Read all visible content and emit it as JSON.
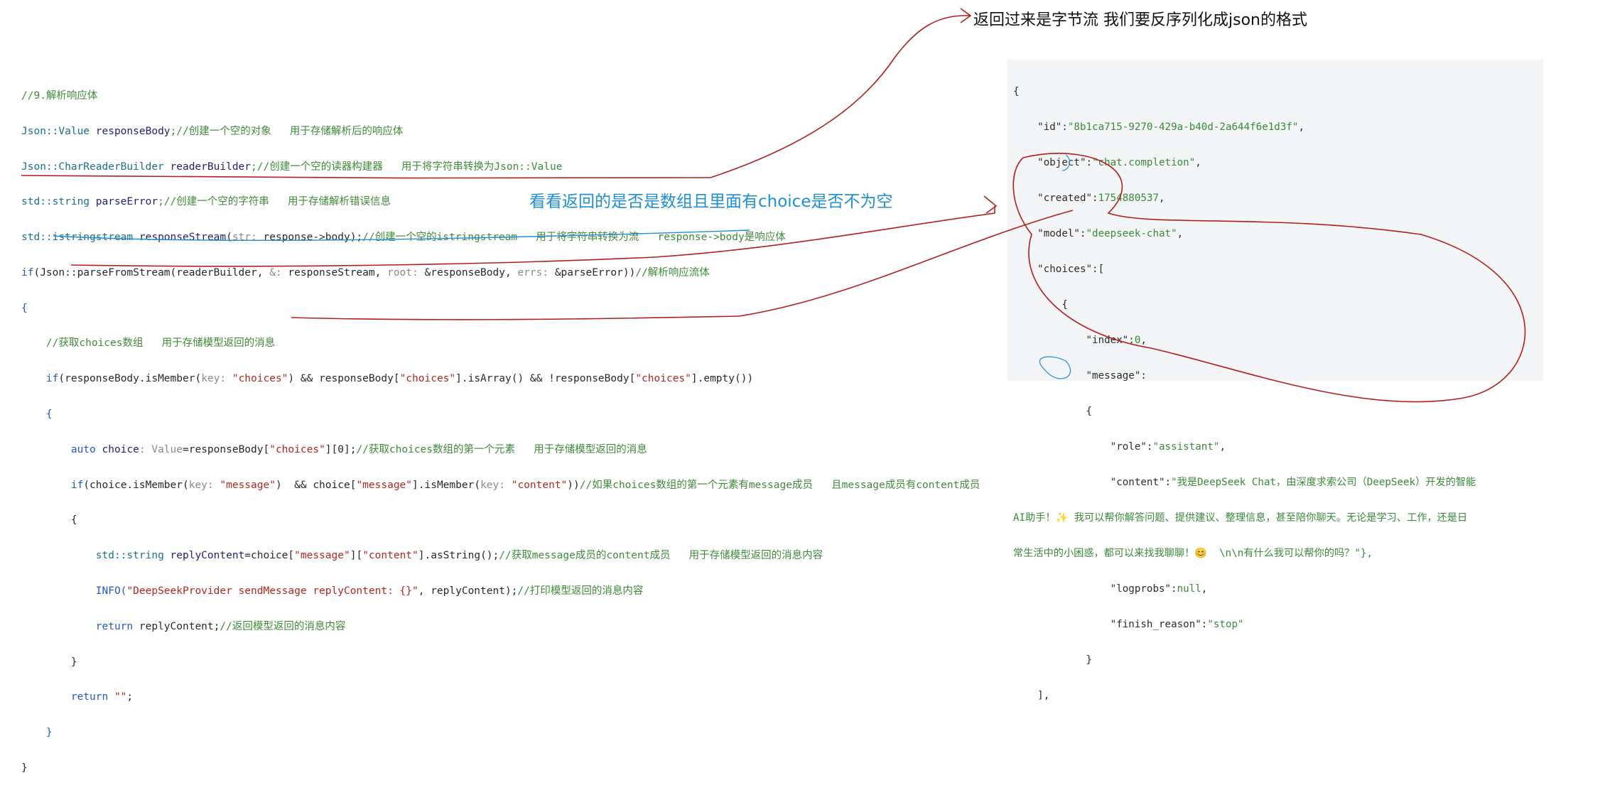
{
  "annotations": {
    "top_note": "返回过来是字节流 我们要反序列化成json的格式",
    "blue_note": "看看返回的是否是数组且里面有choice是否不为空"
  },
  "code": {
    "l1": "//9.解析响应体",
    "l2a": "Json::Value ",
    "l2b": "responseBody",
    "l2c": ";//创建一个空的对象   用于存储解析后的响应体",
    "l3a": "Json::CharReaderBuilder ",
    "l3b": "readerBuilder",
    "l3c": ";//创建一个空的读器构建器   用于将字符串转换为Json::Value",
    "l4a": "std::string ",
    "l4b": "parseError",
    "l4c": ";//创建一个空的字符串   用于存储解析错误信息",
    "l5a": "std::istringstream ",
    "l5b": "responseStream",
    "l5c": "(",
    "l5d": "str: ",
    "l5e": "response->body);",
    "l5f": "//创建一个空的istringstream   用于将字符串转换为流   response->body是响应体",
    "l6a": "if",
    "l6b": "(Json::parseFromStream(readerBuilder, ",
    "l6c": "&: ",
    "l6d": "responseStream, ",
    "l6e": "root: ",
    "l6f": "&responseBody, ",
    "l6g": "errs: ",
    "l6h": "&parseError))",
    "l6i": "//解析响应流体",
    "l7": "{",
    "l8": "//获取choices数组   用于存储模型返回的消息",
    "l9a": "if",
    "l9b": "(responseBody.isMember(",
    "l9c": "key: ",
    "l9d": "\"choices\"",
    "l9e": ") && responseBody[",
    "l9f": "\"choices\"",
    "l9g": "].isArray() && !responseBody[",
    "l9h": "\"choices\"",
    "l9i": "].empty())",
    "l10": "{",
    "l11a": "auto ",
    "l11b": "choice",
    "l11c": ": Value",
    "l11d": "=responseBody[",
    "l11e": "\"choices\"",
    "l11f": "][0];",
    "l11g": "//获取choices数组的第一个元素   用于存储模型返回的消息",
    "l12a": "if",
    "l12b": "(choice.isMember(",
    "l12c": "key: ",
    "l12d": "\"message\"",
    "l12e": ")  && choice[",
    "l12f": "\"message\"",
    "l12g": "].isMember(",
    "l12h": "key: ",
    "l12i": "\"content\"",
    "l12j": "))",
    "l12k": "//如果choices数组的第一个元素有message成员   且message成员有content成员",
    "l13": "{",
    "l14a": "std::string ",
    "l14b": "replyContent",
    "l14c": "=choice[",
    "l14d": "\"message\"",
    "l14e": "][",
    "l14f": "\"content\"",
    "l14g": "].asString();",
    "l14h": "//获取message成员的content成员   用于存储模型返回的消息内容",
    "l15a": "INFO(",
    "l15b": "\"DeepSeekProvider sendMessage replyContent: {}\"",
    "l15c": ", replyContent);",
    "l15d": "//打印模型返回的消息内容",
    "l16a": "return ",
    "l16b": "replyContent;",
    "l16c": "//返回模型返回的消息内容",
    "l17": "}",
    "l18a": "return ",
    "l18b": "\"\"",
    "l18c": ";",
    "l19": "}",
    "l20": "}"
  },
  "json": {
    "j1": "{",
    "j2k": "\"id\"",
    "j2v": "\"8b1ca715-9270-429a-b40d-2a644f6e1d3f\"",
    "j3k": "\"object\"",
    "j3v": "\"chat.completion\"",
    "j4k": "\"created\"",
    "j4v": "1754880537",
    "j5k": "\"model\"",
    "j5v": "\"deepseek-chat\"",
    "j6k": "\"choices\"",
    "j6v": "[",
    "j7": "{",
    "j8k": "\"index\"",
    "j8v": "0",
    "j9k": "\"message\"",
    "j10": "{",
    "j11k": "\"role\"",
    "j11v": "\"assistant\"",
    "j12k": "\"content\"",
    "j12v": "\"我是DeepSeek Chat，由深度求索公司（DeepSeek）开发的智能",
    "j13": "AI助手！✨ 我可以帮你解答问题、提供建议、整理信息，甚至陪你聊天。无论是学习、工作，还是日",
    "j14": "常生活中的小困惑，都可以来找我聊聊！😊  \\n\\n有什么我可以帮你的吗？\"},",
    "j15k": "\"logprobs\"",
    "j15v": "null",
    "j16k": "\"finish_reason\"",
    "j16v": "\"stop\"",
    "j17": "}",
    "j18": "],"
  }
}
